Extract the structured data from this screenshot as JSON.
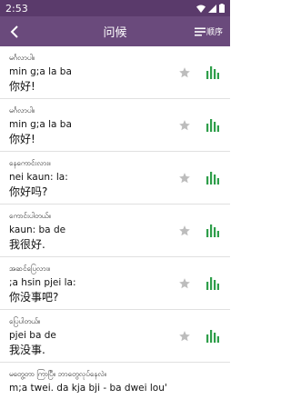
{
  "status_bar": {
    "time": "2:53"
  },
  "app_bar": {
    "title": "问候",
    "order_label": "顺序"
  },
  "colors": {
    "status_bar": "#5a3a6b",
    "app_bar": "#6a4a7c",
    "audio_bars": "#2e9e4a",
    "star": "#bdbdbd"
  },
  "phrases": [
    {
      "myanmar": "မင်္ဂလာပါ။",
      "romanization": "min g;a la ba",
      "chinese": "你好!"
    },
    {
      "myanmar": "မင်္ဂလာပါ။",
      "romanization": "min g;a la ba",
      "chinese": "你好!"
    },
    {
      "myanmar": "နေကောင်းလား။",
      "romanization": "nei kaun: la:",
      "chinese": "你好吗?"
    },
    {
      "myanmar": "ကောင်းပါတယ်။",
      "romanization": "kaun: ba de",
      "chinese": "我很好."
    },
    {
      "myanmar": "အဆင်ပြေလား။",
      "romanization": ";a hsin pjei la:",
      "chinese": "你没事吧?"
    },
    {
      "myanmar": "ပြေပါတယ်။",
      "romanization": "pjei ba de",
      "chinese": "我没事."
    },
    {
      "myanmar": "မတွေ့တာ ကြာပြီ။ ဘာတွေလုပ်နေလဲ။",
      "romanization": "m;a twei. da kja bji - ba dwei lou'",
      "chinese": ""
    }
  ]
}
